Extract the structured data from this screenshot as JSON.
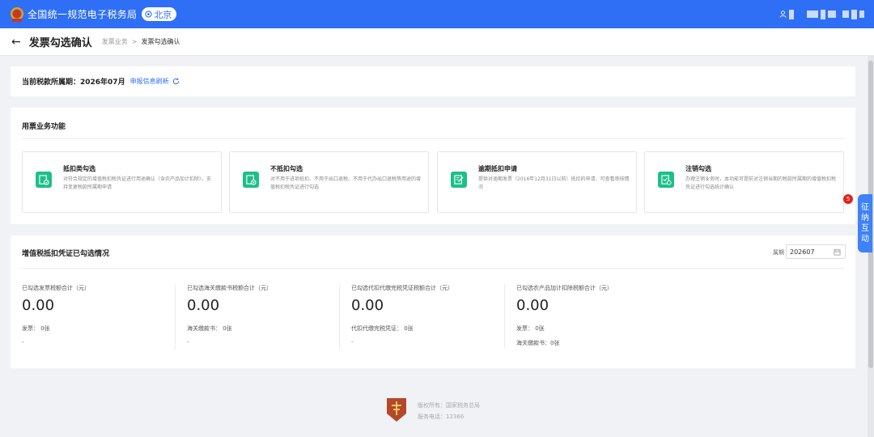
{
  "header": {
    "app_title": "全国统一规范电子税务局",
    "region": "北京"
  },
  "page": {
    "title": "发票勾选确认",
    "breadcrumb": [
      "发票业务",
      "发票勾选确认"
    ]
  },
  "period": {
    "label": "当前税款所属期：2026年07月",
    "refresh_label": "申报信息刷新"
  },
  "functions": {
    "section_title": "用票业务功能",
    "items": [
      {
        "name": "抵扣类勾选",
        "desc": "对符合规定的增值税扣税凭证进行用途确认（含农产品加计扣除），支持变更税款所属期申请"
      },
      {
        "name": "不抵扣勾选",
        "desc": "对不用于进项抵扣、不用于出口退税、不用于代办出口退税等用途的增值税扣税凭证进行勾选"
      },
      {
        "name": "逾期抵扣申请",
        "desc": "提供对逾期发票（2016年12月31日以前）抵扣的申请、可查看审核情况"
      },
      {
        "name": "注销勾选",
        "desc": "办理注销业务时，本功能可提前对注销当期的税款所属期的增值税扣税凭证进行勾选统计确认"
      }
    ]
  },
  "stats": {
    "section_title": "增值税抵扣凭证已勾选情况",
    "period_label": "属期",
    "period_value": "202607",
    "columns": [
      {
        "label": "已勾选发票税额合计（元）",
        "value": "0.00",
        "lines": [
          "发票：  0张"
        ],
        "dash": "-"
      },
      {
        "label": "已勾选海关缴款书税额合计（元）",
        "value": "0.00",
        "lines": [
          "海关缴款书：  0张"
        ],
        "dash": "-"
      },
      {
        "label": "已勾选代扣代缴完税凭证税额合计（元）",
        "value": "0.00",
        "lines": [
          "代扣代缴完税凭证：  0张"
        ],
        "dash": "-"
      },
      {
        "label": "已勾选农产品加计扣除税额合计（元）",
        "value": "0.00",
        "lines": [
          "发票：  0张",
          "海关缴款书：0张"
        ],
        "dash": ""
      }
    ]
  },
  "footer": {
    "copyright": "版权所有：国家税务总局",
    "phone": "服务电话：12366"
  },
  "side_tab": {
    "chars": [
      "征",
      "纳",
      "互",
      "动"
    ],
    "badge": "5"
  },
  "colors": {
    "primary": "#2e6ff5",
    "function_icon": "#1dbf8a",
    "badge": "#e2231a"
  }
}
